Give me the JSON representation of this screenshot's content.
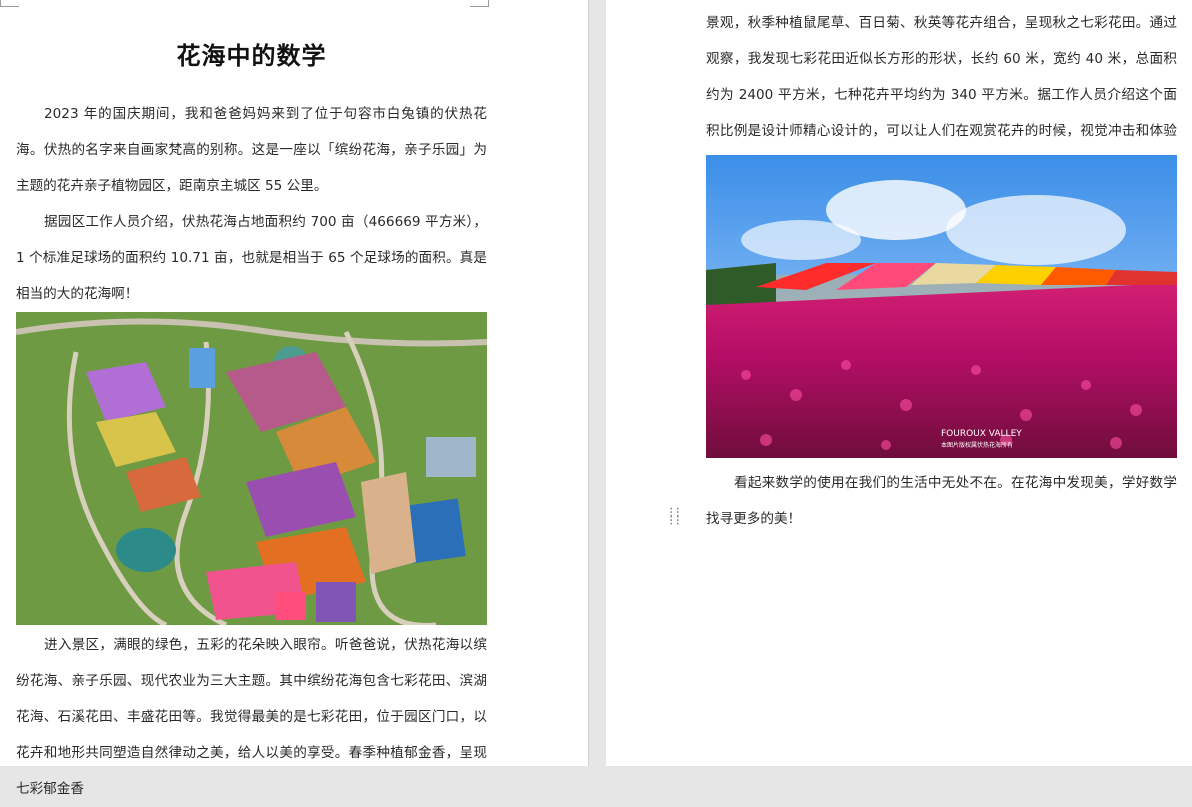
{
  "document": {
    "title": "花海中的数学",
    "left_paragraphs": [
      "2023 年的国庆期间，我和爸爸妈妈来到了位于句容市白兔镇的伏热花海。伏热的名字来自画家梵高的别称。这是一座以「缤纷花海，亲子乐园」为主题的花卉亲子植物园区，距南京主城区 55 公里。",
      "据园区工作人员介绍，伏热花海占地面积约 700 亩（466669 平方米），1 个标准足球场的面积约 10.71 亩，也就是相当于 65 个足球场的面积。真是相当的大的花海啊！"
    ],
    "left_paragraph_after_image": "进入景区，满眼的绿色，五彩的花朵映入眼帘。听爸爸说，伏热花海以缤纷花海、亲子乐园、现代农业为三大主题。其中缤纷花海包含七彩花田、滨湖花海、石溪花田、丰盛花田等。我觉得最美的是七彩花田，位于园区门口，以花卉和地形共同塑造自然律动之美，给人以美的享受。春季种植郁金香，呈现七彩郁金香",
    "right_paragraph_top": "景观，秋季种植鼠尾草、百日菊、秋英等花卉组合，呈现秋之七彩花田。通过观察，我发现七彩花田近似长方形的形状，长约 60 米，宽约 40 米，总面积约为 2400 平方米，七种花卉平均约为 340 平方米。据工作人员介绍这个面积比例是设计师精心设计的，可以让人们在观赏花卉的时候，视觉冲击和体验最为舒服。",
    "right_paragraph_bottom": "看起来数学的使用在我们的生活中无处不在。在花海中发现美，学好数学找寻更多的美！",
    "photo_watermark_main": "FOUROUX VALLEY",
    "photo_watermark_sub": "本图片版权属伏热花海所有"
  },
  "icons": {
    "drag_handle": "drag-handle-icon"
  },
  "colors": {
    "page": "#ffffff",
    "workspace": "#e6e6e6",
    "text": "#2a2a2a"
  }
}
